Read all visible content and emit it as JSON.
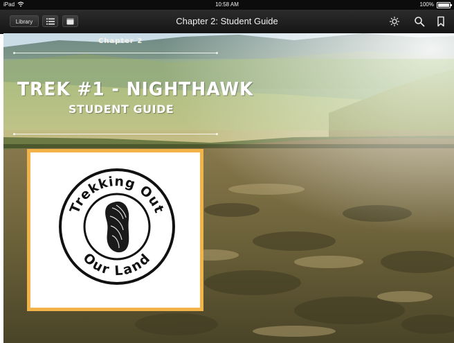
{
  "status_bar": {
    "device": "iPad",
    "time": "10:58 AM",
    "battery": "100%"
  },
  "toolbar": {
    "library_label": "Library",
    "title": "Chapter 2: Student Guide",
    "icons": {
      "toc": "list-icon",
      "notes": "notes-icon",
      "brightness": "brightness-icon",
      "search": "search-icon",
      "bookmark": "bookmark-icon"
    }
  },
  "page": {
    "chapter_label": "Chapter 2",
    "title": "TREK #1 - NIGHTHAWK",
    "subtitle": "STUDENT GUIDE",
    "logo": {
      "text": "Trekking Out Our Land"
    }
  },
  "colors": {
    "toolbar_bg": "#1f1f1f",
    "card_border": "#f2b448",
    "title_text": "#ffffff"
  }
}
